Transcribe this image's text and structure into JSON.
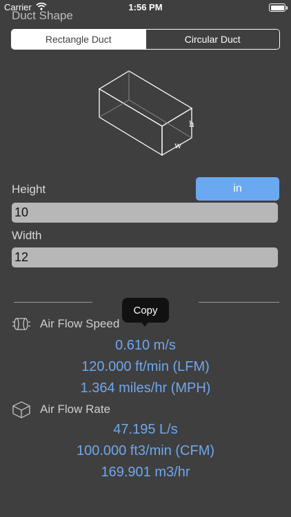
{
  "status_bar": {
    "carrier": "Carrier",
    "time": "1:56 PM"
  },
  "duct_shape": {
    "title": "Duct Shape",
    "segments": [
      "Rectangle Duct",
      "Circular Duct"
    ],
    "selected": "Rectangle Duct",
    "diagram_labels": {
      "height": "h",
      "width": "w"
    }
  },
  "dimensions": {
    "height_label": "Height",
    "unit_button": "in",
    "height_value": "10",
    "width_label": "Width",
    "width_value": "12"
  },
  "tooltip": {
    "label": "Copy"
  },
  "air_flow_speed": {
    "label": "Air Flow Speed",
    "values": [
      "0.610 m/s",
      "120.000 ft/min (LFM)",
      "1.364 miles/hr (MPH)"
    ]
  },
  "air_flow_rate": {
    "label": "Air Flow Rate",
    "values": [
      "47.195 L/s",
      "100.000 ft3/min (CFM)",
      "169.901 m3/hr"
    ]
  },
  "colors": {
    "background": "#3f3f3f",
    "accent": "#6aa9f2",
    "value_text": "#6fa8ee",
    "input_bg": "#b7b7b7"
  },
  "icons": {
    "speed": "air-flow-speed-icon",
    "rate": "cube-icon"
  }
}
